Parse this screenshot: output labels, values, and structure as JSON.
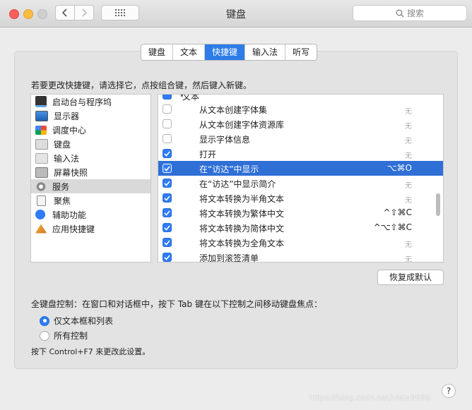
{
  "window": {
    "title": "键盘",
    "search_placeholder": "搜索"
  },
  "tabs": [
    {
      "label": "键盘",
      "active": false
    },
    {
      "label": "文本",
      "active": false
    },
    {
      "label": "快捷键",
      "active": true
    },
    {
      "label": "输入法",
      "active": false
    },
    {
      "label": "听写",
      "active": false
    }
  ],
  "instruction": "若要更改快捷键，请选择它，点按组合键，然后键入新键。",
  "categories": [
    {
      "label": "启动台与程序坞",
      "icon": "launchpad-dock-icon",
      "selected": false
    },
    {
      "label": "显示器",
      "icon": "display-icon",
      "selected": false
    },
    {
      "label": "调度中心",
      "icon": "mission-control-icon",
      "selected": false
    },
    {
      "label": "键盘",
      "icon": "keyboard-icon",
      "selected": false
    },
    {
      "label": "输入法",
      "icon": "input-source-icon",
      "selected": false
    },
    {
      "label": "屏幕快照",
      "icon": "screenshot-icon",
      "selected": false
    },
    {
      "label": "服务",
      "icon": "services-gear-icon",
      "selected": true
    },
    {
      "label": "聚焦",
      "icon": "spotlight-icon",
      "selected": false
    },
    {
      "label": "辅助功能",
      "icon": "accessibility-icon",
      "selected": false
    },
    {
      "label": "应用快捷键",
      "icon": "app-shortcuts-icon",
      "selected": false
    }
  ],
  "shortcuts": {
    "group_label": "文本",
    "rows": [
      {
        "label": "从文本创建字体集",
        "checked": false,
        "key": "无",
        "none": true,
        "selected": false
      },
      {
        "label": "从文本创建字体资源库",
        "checked": false,
        "key": "无",
        "none": true,
        "selected": false
      },
      {
        "label": "显示字体信息",
        "checked": false,
        "key": "无",
        "none": true,
        "selected": false
      },
      {
        "label": "打开",
        "checked": true,
        "key": "无",
        "none": true,
        "selected": false
      },
      {
        "label": "在“访达”中显示",
        "checked": true,
        "key": "⌥⌘O",
        "none": false,
        "selected": true
      },
      {
        "label": "在“访达”中显示简介",
        "checked": true,
        "key": "无",
        "none": true,
        "selected": false
      },
      {
        "label": "将文本转换为半角文本",
        "checked": true,
        "key": "无",
        "none": true,
        "selected": false
      },
      {
        "label": "将文本转换为繁体中文",
        "checked": true,
        "key": "^⇧⌘C",
        "none": false,
        "selected": false
      },
      {
        "label": "将文本转换为简体中文",
        "checked": true,
        "key": "^⌥⇧⌘C",
        "none": false,
        "selected": false
      },
      {
        "label": "将文本转换为全角文本",
        "checked": true,
        "key": "无",
        "none": true,
        "selected": false
      },
      {
        "label": "添加到滚签清单",
        "checked": true,
        "key": "无",
        "none": true,
        "selected": false
      }
    ]
  },
  "restore_button": "恢复成默认",
  "keyboard_control": {
    "label": "全键盘控制：在窗口和对话框中，按下 Tab 键在以下控制之间移动键盘焦点：",
    "options": [
      {
        "label": "仅文本框和列表",
        "selected": true
      },
      {
        "label": "所有控制",
        "selected": false
      }
    ],
    "hint": "按下 Control+F7 来更改此设置。"
  },
  "help_label": "?",
  "watermark": "https://blog.csdn.net/vista9999",
  "colors": {
    "accent": "#2e7cf6",
    "selection": "#2f6fd6",
    "close": "#fc605c",
    "minimize": "#fdbc40"
  }
}
